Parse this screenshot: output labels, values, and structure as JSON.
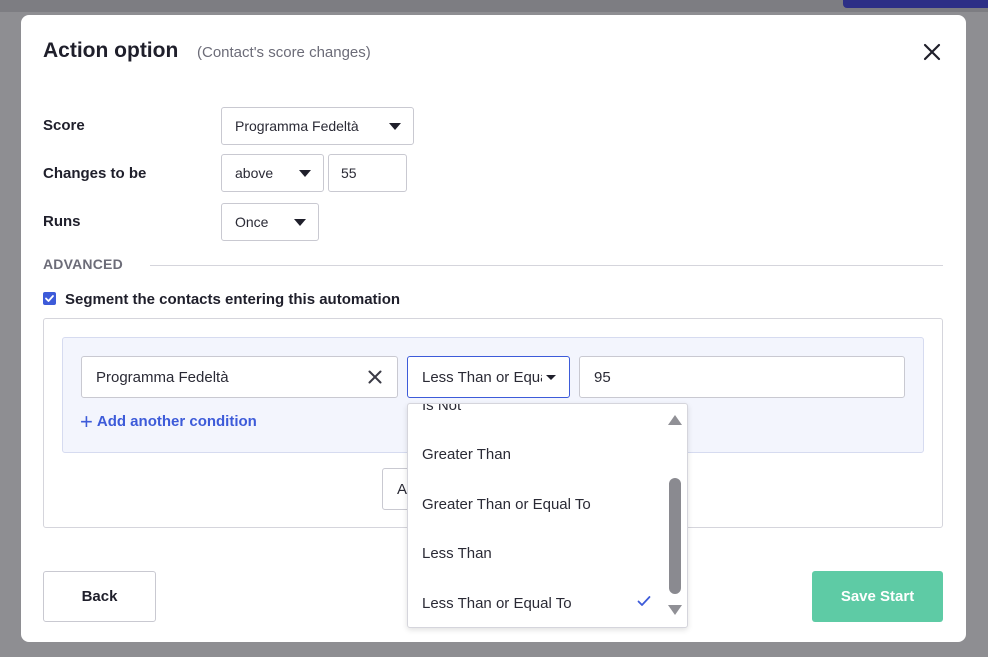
{
  "dialog": {
    "title": "Action option",
    "subtitle": "(Contact's score changes)"
  },
  "form": {
    "score_label": "Score",
    "score_value": "Programma Fedeltà",
    "changes_label": "Changes to be",
    "changes_direction": "above",
    "changes_value": "55",
    "runs_label": "Runs",
    "runs_value": "Once"
  },
  "advanced": {
    "heading": "ADVANCED",
    "segment_label": "Segment the contacts entering this automation",
    "segment_checked": true
  },
  "condition": {
    "field": "Programma Fedeltà",
    "operator": "Less Than or Equal To",
    "value": "95",
    "add_label": "Add another condition",
    "partial_button_label": "A"
  },
  "operator_dropdown": {
    "options": [
      "Is Not",
      "Greater Than",
      "Greater Than or Equal To",
      "Less Than",
      "Less Than or Equal To"
    ],
    "selected": "Less Than or Equal To"
  },
  "footer": {
    "back_label": "Back",
    "save_label": "Save Start"
  },
  "colors": {
    "accent": "#3d5bd9",
    "save": "#5ecba5"
  }
}
